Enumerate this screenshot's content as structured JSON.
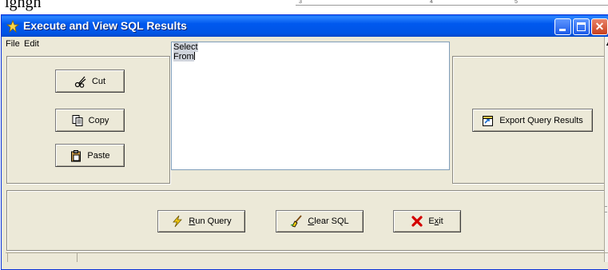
{
  "background": {
    "partial_text": "ighgh",
    "ruler_marks": [
      "3",
      "4",
      "5"
    ]
  },
  "window": {
    "title": "Execute and View SQL Results",
    "title_color": "#ffffff",
    "titlebar_color": "#0055e5"
  },
  "menubar": {
    "items": [
      "File",
      "Edit"
    ]
  },
  "clipboard_panel": {
    "cut": {
      "label": "Cut",
      "icon": "scissors-icon"
    },
    "copy": {
      "label": "Copy",
      "icon": "copy-icon"
    },
    "paste": {
      "label": "Paste",
      "icon": "paste-icon"
    }
  },
  "sql_editor": {
    "lines": [
      "Select",
      "From"
    ]
  },
  "export_panel": {
    "export": {
      "label": "Export Query Results",
      "icon": "export-icon"
    }
  },
  "actions": {
    "run": {
      "prefix": "",
      "accel": "R",
      "rest": "un Query",
      "icon": "run-icon"
    },
    "clear": {
      "prefix": "",
      "accel": "C",
      "rest": "lear SQL",
      "icon": "clear-icon"
    },
    "exit": {
      "prefix": "E",
      "accel": "x",
      "rest": "it",
      "icon": "exit-icon"
    }
  }
}
